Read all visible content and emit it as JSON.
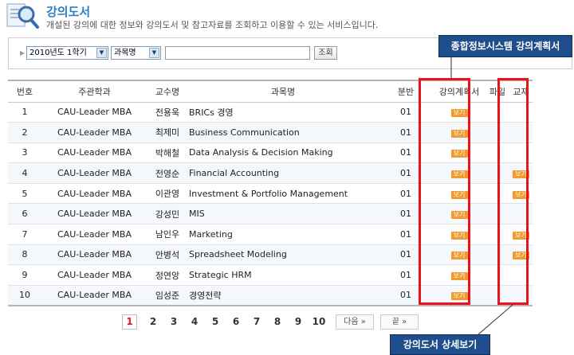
{
  "header": {
    "title": "강의도서",
    "description": "개설된 강의에 대한 정보와 강의도서 및 참고자료를 조회하고 이용할 수 있는 서비스입니다."
  },
  "search": {
    "term_selected": "2010년도 1학기",
    "field_selected": "과목명",
    "query_value": "",
    "button_label": "조회"
  },
  "table": {
    "headers": [
      "번호",
      "주관학과",
      "교수명",
      "과목명",
      "분반",
      "강의계획서",
      "파일",
      "교재"
    ],
    "rows": [
      {
        "no": "1",
        "dept": "CAU-Leader MBA",
        "prof": "전용욱",
        "title": "BRICs 경영",
        "section": "01",
        "plan": "보기",
        "file": "",
        "text": ""
      },
      {
        "no": "2",
        "dept": "CAU-Leader MBA",
        "prof": "최제미",
        "title": "Business Communication",
        "section": "01",
        "plan": "보기",
        "file": "",
        "text": ""
      },
      {
        "no": "3",
        "dept": "CAU-Leader MBA",
        "prof": "박해철",
        "title": "Data Analysis & Decision Making",
        "section": "01",
        "plan": "보기",
        "file": "",
        "text": ""
      },
      {
        "no": "4",
        "dept": "CAU-Leader MBA",
        "prof": "전영순",
        "title": "Financial Accounting",
        "section": "01",
        "plan": "보기",
        "file": "",
        "text": "보기"
      },
      {
        "no": "5",
        "dept": "CAU-Leader MBA",
        "prof": "이관영",
        "title": "Investment & Portfolio Management",
        "section": "01",
        "plan": "보기",
        "file": "",
        "text": "보기"
      },
      {
        "no": "6",
        "dept": "CAU-Leader MBA",
        "prof": "강성민",
        "title": "MIS",
        "section": "01",
        "plan": "보기",
        "file": "",
        "text": ""
      },
      {
        "no": "7",
        "dept": "CAU-Leader MBA",
        "prof": "남인우",
        "title": "Marketing",
        "section": "01",
        "plan": "보기",
        "file": "",
        "text": "보기"
      },
      {
        "no": "8",
        "dept": "CAU-Leader MBA",
        "prof": "안병석",
        "title": "Spreadsheet Modeling",
        "section": "01",
        "plan": "보기",
        "file": "",
        "text": "보기"
      },
      {
        "no": "9",
        "dept": "CAU-Leader MBA",
        "prof": "정연앙",
        "title": "Strategic HRM",
        "section": "01",
        "plan": "보기",
        "file": "",
        "text": ""
      },
      {
        "no": "10",
        "dept": "CAU-Leader MBA",
        "prof": "임성준",
        "title": "경영전략",
        "section": "01",
        "plan": "보기",
        "file": "",
        "text": ""
      }
    ]
  },
  "pagination": {
    "pages": [
      "1",
      "2",
      "3",
      "4",
      "5",
      "6",
      "7",
      "8",
      "9",
      "10"
    ],
    "current": "1",
    "next_label": "다음 »",
    "last_label": "끝 »"
  },
  "annotations": {
    "plan_callout": "종합정보시스템 강의계획서",
    "detail_callout": "강의도서 상세보기",
    "highlight_color": "#e8141b",
    "callout_color": "#1f4e8c"
  },
  "colors": {
    "title_blue": "#2b7fc4",
    "badge_orange": "#f39a2e",
    "current_page_red": "#e8141b"
  },
  "icons": {
    "header": "magnifier-document-icon",
    "search_arrow": "triangle-right-icon",
    "dropdown": "chevron-down-icon"
  }
}
